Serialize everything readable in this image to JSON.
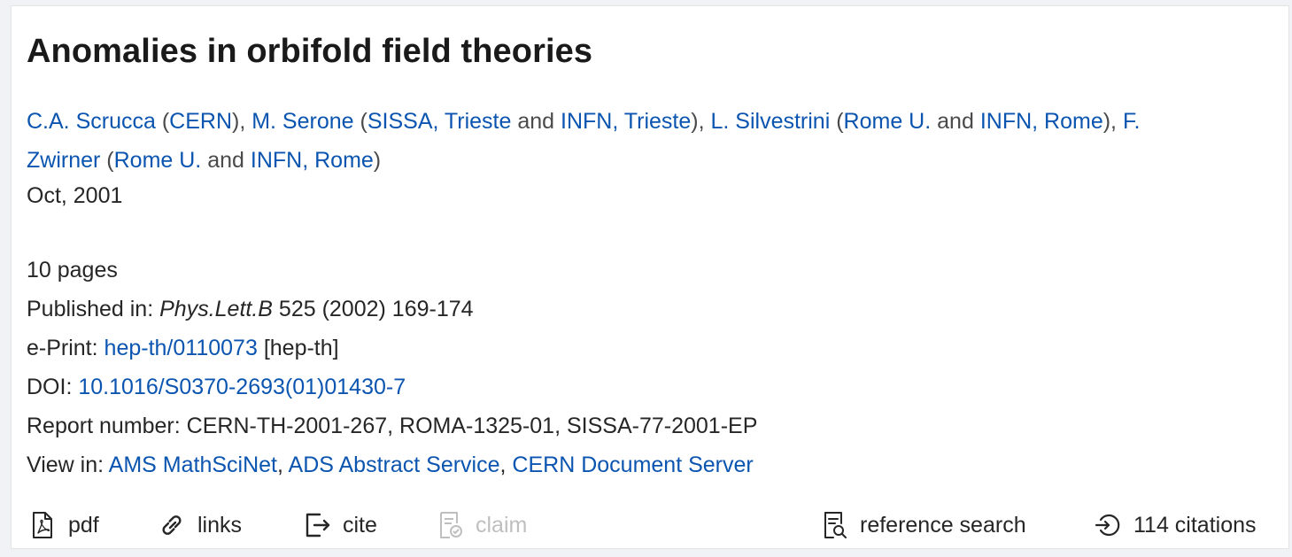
{
  "title": "Anomalies in orbifold field theories",
  "authors": [
    {
      "name": "C.A. Scrucca",
      "affiliations": [
        "CERN"
      ]
    },
    {
      "name": "M. Serone",
      "affiliations": [
        "SISSA, Trieste",
        "INFN, Trieste"
      ]
    },
    {
      "name": "L. Silvestrini",
      "affiliations": [
        "Rome U.",
        "INFN, Rome"
      ]
    },
    {
      "name": "F. Zwirner",
      "affiliations": [
        "Rome U.",
        "INFN, Rome"
      ]
    }
  ],
  "affiliation_joiner": "and",
  "date": "Oct, 2001",
  "pages": "10 pages",
  "published": {
    "label": "Published in:",
    "journal": "Phys.Lett.B",
    "details": "525 (2002) 169-174"
  },
  "eprint": {
    "label": "e-Print:",
    "id": "hep-th/0110073",
    "category": "[hep-th]"
  },
  "doi": {
    "label": "DOI:",
    "value": "10.1016/S0370-2693(01)01430-7"
  },
  "report": {
    "label": "Report number:",
    "value": "CERN-TH-2001-267, ROMA-1325-01, SISSA-77-2001-EP"
  },
  "view_in": {
    "label": "View in:",
    "links": [
      "AMS MathSciNet",
      "ADS Abstract Service",
      "CERN Document Server"
    ]
  },
  "actions": {
    "pdf": "pdf",
    "links": "links",
    "cite": "cite",
    "claim": "claim",
    "reference_search": "reference search",
    "citations": "114 citations"
  },
  "colors": {
    "link": "#0b55b0",
    "text": "#262626",
    "disabled": "#bfbfbf"
  },
  "icons": [
    "file-pdf-icon",
    "link-icon",
    "export-icon",
    "file-claim-icon",
    "file-search-icon",
    "login-icon"
  ]
}
